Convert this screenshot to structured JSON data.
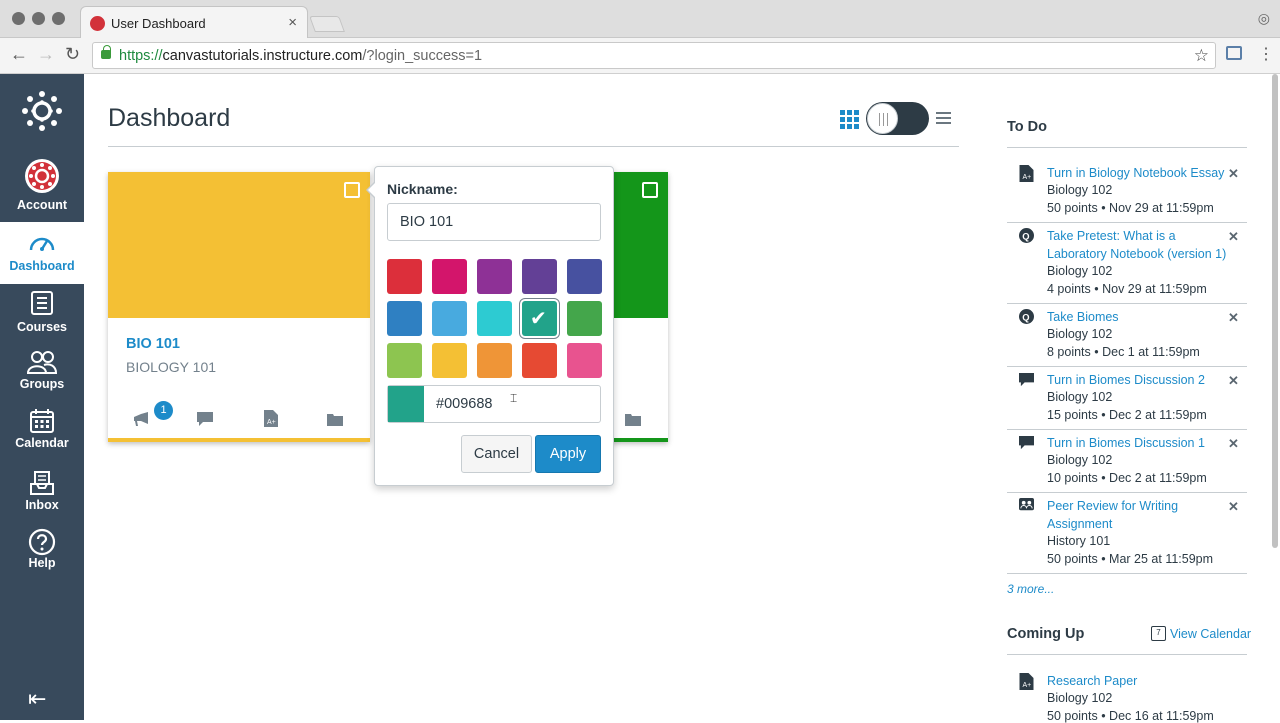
{
  "browser": {
    "tab_title": "User Dashboard",
    "tab_close": "×",
    "url_scheme": "https://",
    "url_domain": "canvastutorials.instructure.com",
    "url_path": "/?login_success=1",
    "star": "☆"
  },
  "leftnav": {
    "items": [
      {
        "label": "Account"
      },
      {
        "label": "Dashboard"
      },
      {
        "label": "Courses"
      },
      {
        "label": "Groups"
      },
      {
        "label": "Calendar"
      },
      {
        "label": "Inbox"
      },
      {
        "label": "Help"
      }
    ],
    "collapse": "⇤"
  },
  "main": {
    "title": "Dashboard"
  },
  "cards": [
    {
      "name": "BIO 101",
      "subtitle": "BIOLOGY 101",
      "color": "#f4c034",
      "badge": "1"
    },
    {
      "color": "#14961a"
    }
  ],
  "popover": {
    "nickname_label": "Nickname:",
    "nickname_value": "BIO 101",
    "swatches": [
      "#dc2f3b",
      "#d3156b",
      "#8e3196",
      "#634096",
      "#4751a0",
      "#2f80c2",
      "#48aadf",
      "#2dcbd2",
      "#22a38a",
      "#44a64b",
      "#8dc550",
      "#f4c034",
      "#ef9537",
      "#e64a33",
      "#e8538f"
    ],
    "selected_swatch": "#22a38a",
    "hex_value": "#009688",
    "cancel_label": "Cancel",
    "apply_label": "Apply"
  },
  "todo": {
    "heading": "To Do",
    "items": [
      {
        "title": "Turn in Biology Notebook Essay",
        "course": "Biology 102",
        "meta": "50 points • Nov 29 at 11:59pm",
        "icon": "assignment-icon"
      },
      {
        "title": "Take Pretest: What is a Laboratory Notebook (version 1)",
        "course": "Biology 102",
        "meta": "4 points • Nov 29 at 11:59pm",
        "icon": "quiz-icon"
      },
      {
        "title": "Take Biomes",
        "course": "Biology 102",
        "meta": "8 points • Dec 1 at 11:59pm",
        "icon": "quiz-icon"
      },
      {
        "title": "Turn in Biomes Discussion 2",
        "course": "Biology 102",
        "meta": "15 points • Dec 2 at 11:59pm",
        "icon": "discussion-icon"
      },
      {
        "title": "Turn in Biomes Discussion 1",
        "course": "Biology 102",
        "meta": "10 points • Dec 2 at 11:59pm",
        "icon": "discussion-icon"
      },
      {
        "title": "Peer Review for Writing Assignment",
        "course": "History 101",
        "meta": "50 points • Mar 25 at 11:59pm",
        "icon": "peer-review-icon"
      }
    ],
    "more": "3 more...",
    "remove": "✕"
  },
  "coming_up": {
    "heading": "Coming Up",
    "view_calendar": "View Calendar",
    "calendar_icon_text": "7",
    "items": [
      {
        "title": "Research Paper",
        "course": "Biology 102",
        "meta": "50 points • Dec 16 at 11:59pm"
      }
    ]
  }
}
